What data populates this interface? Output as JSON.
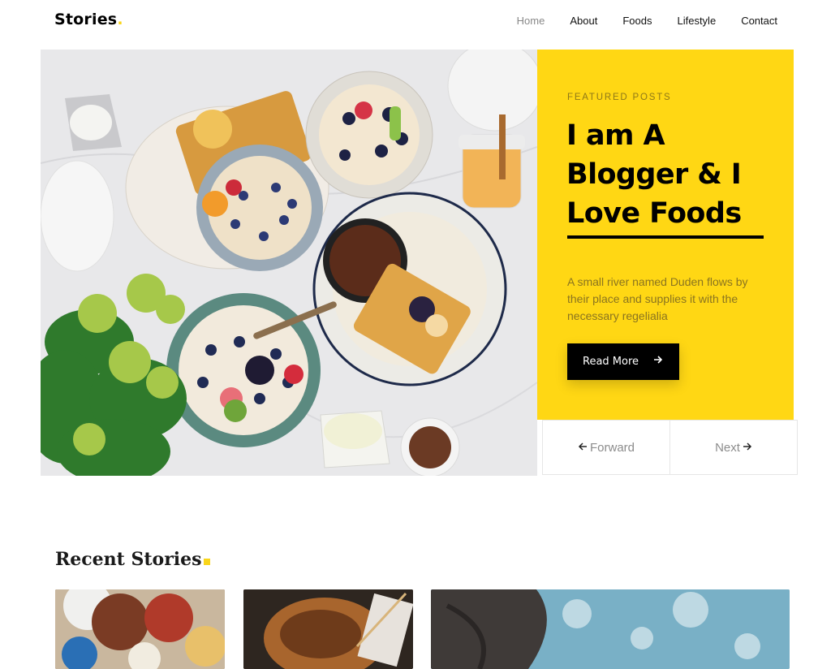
{
  "header": {
    "logo": "Stories",
    "logo_dot": ".",
    "nav": [
      "Home",
      "About",
      "Foods",
      "Lifestyle",
      "Contact"
    ]
  },
  "featured": {
    "label": "FEATURED POSTS",
    "title": "I am A Blogger & I Love Foods",
    "description": "A small river named Duden flows by their place and supplies it with the necessary regelialia",
    "button_label": "Read More",
    "button_icon": "arrow-right-icon"
  },
  "pager": {
    "forward": "Forward",
    "next": "Next"
  },
  "recent": {
    "title": "Recent Stories"
  },
  "colors": {
    "accent": "#ffd714",
    "dark": "#000000"
  }
}
